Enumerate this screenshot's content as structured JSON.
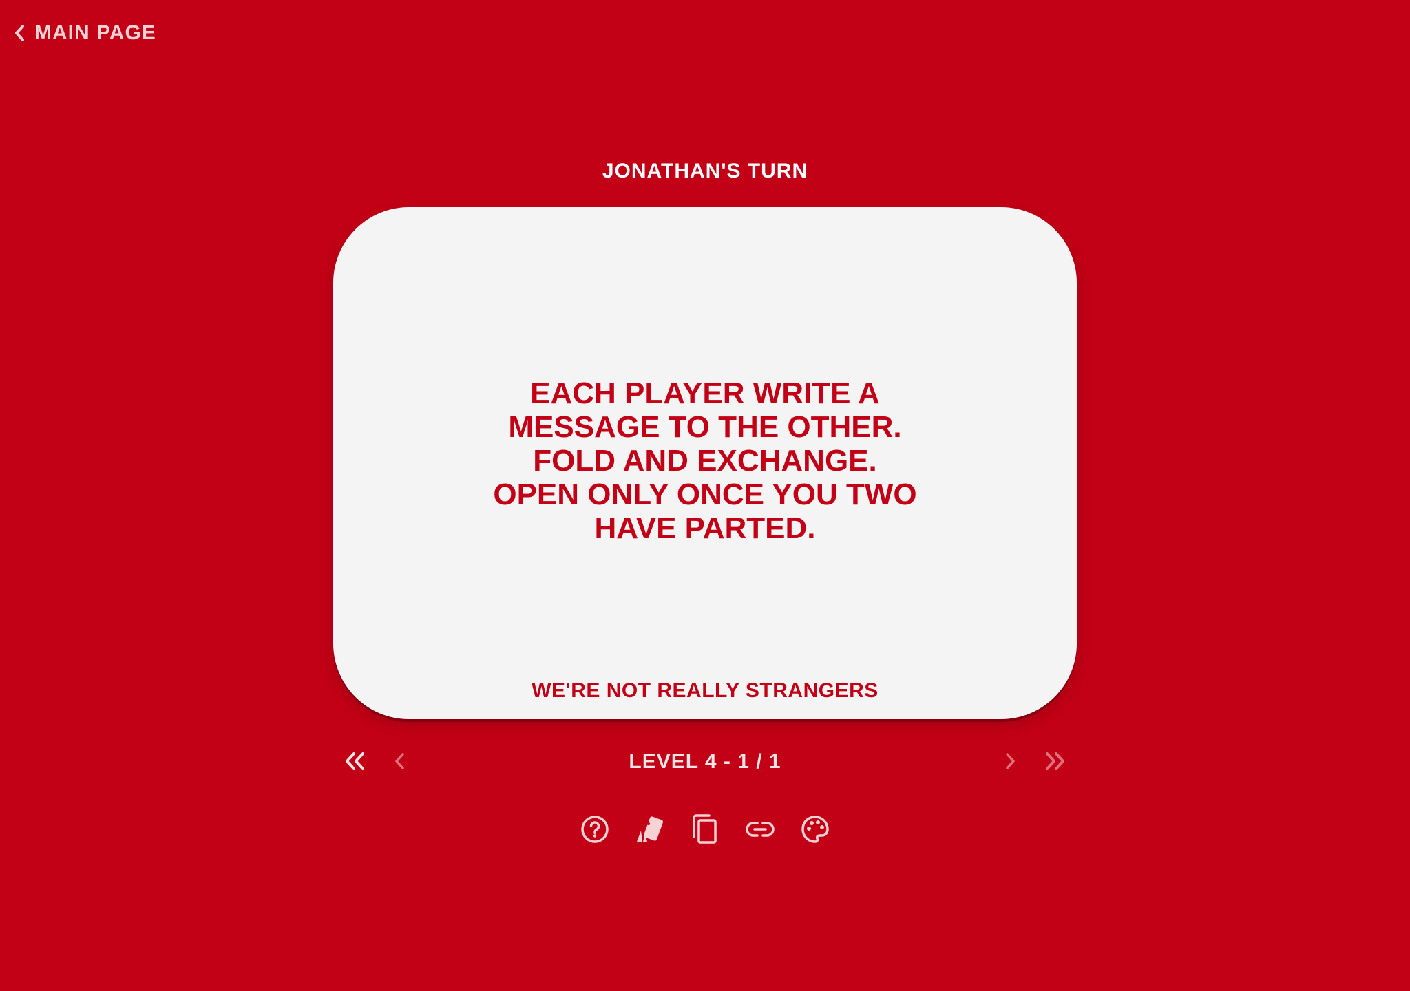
{
  "header": {
    "back_label": "MAIN PAGE"
  },
  "turn": {
    "label": "JONATHAN'S TURN"
  },
  "card": {
    "text": "EACH PLAYER WRITE A\nMESSAGE TO THE OTHER.\nFOLD AND EXCHANGE.\nOPEN ONLY ONCE YOU TWO\nHAVE PARTED.",
    "deck_name": "WE'RE NOT REALLY STRANGERS"
  },
  "navigation": {
    "level_label": "LEVEL 4 - 1 / 1",
    "first_icon": "double-chevron-left-icon",
    "prev_icon": "chevron-left-icon",
    "next_icon": "chevron-right-icon",
    "last_icon": "double-chevron-right-icon"
  },
  "toolbar": {
    "items": [
      {
        "icon": "help-circle-icon"
      },
      {
        "icon": "cards-icon"
      },
      {
        "icon": "copy-icon"
      },
      {
        "icon": "link-icon"
      },
      {
        "icon": "palette-icon"
      }
    ]
  },
  "colors": {
    "background": "#c20016",
    "card": "#f4f4f4",
    "accent_text": "#c20016",
    "light_text": "#ffffff"
  }
}
